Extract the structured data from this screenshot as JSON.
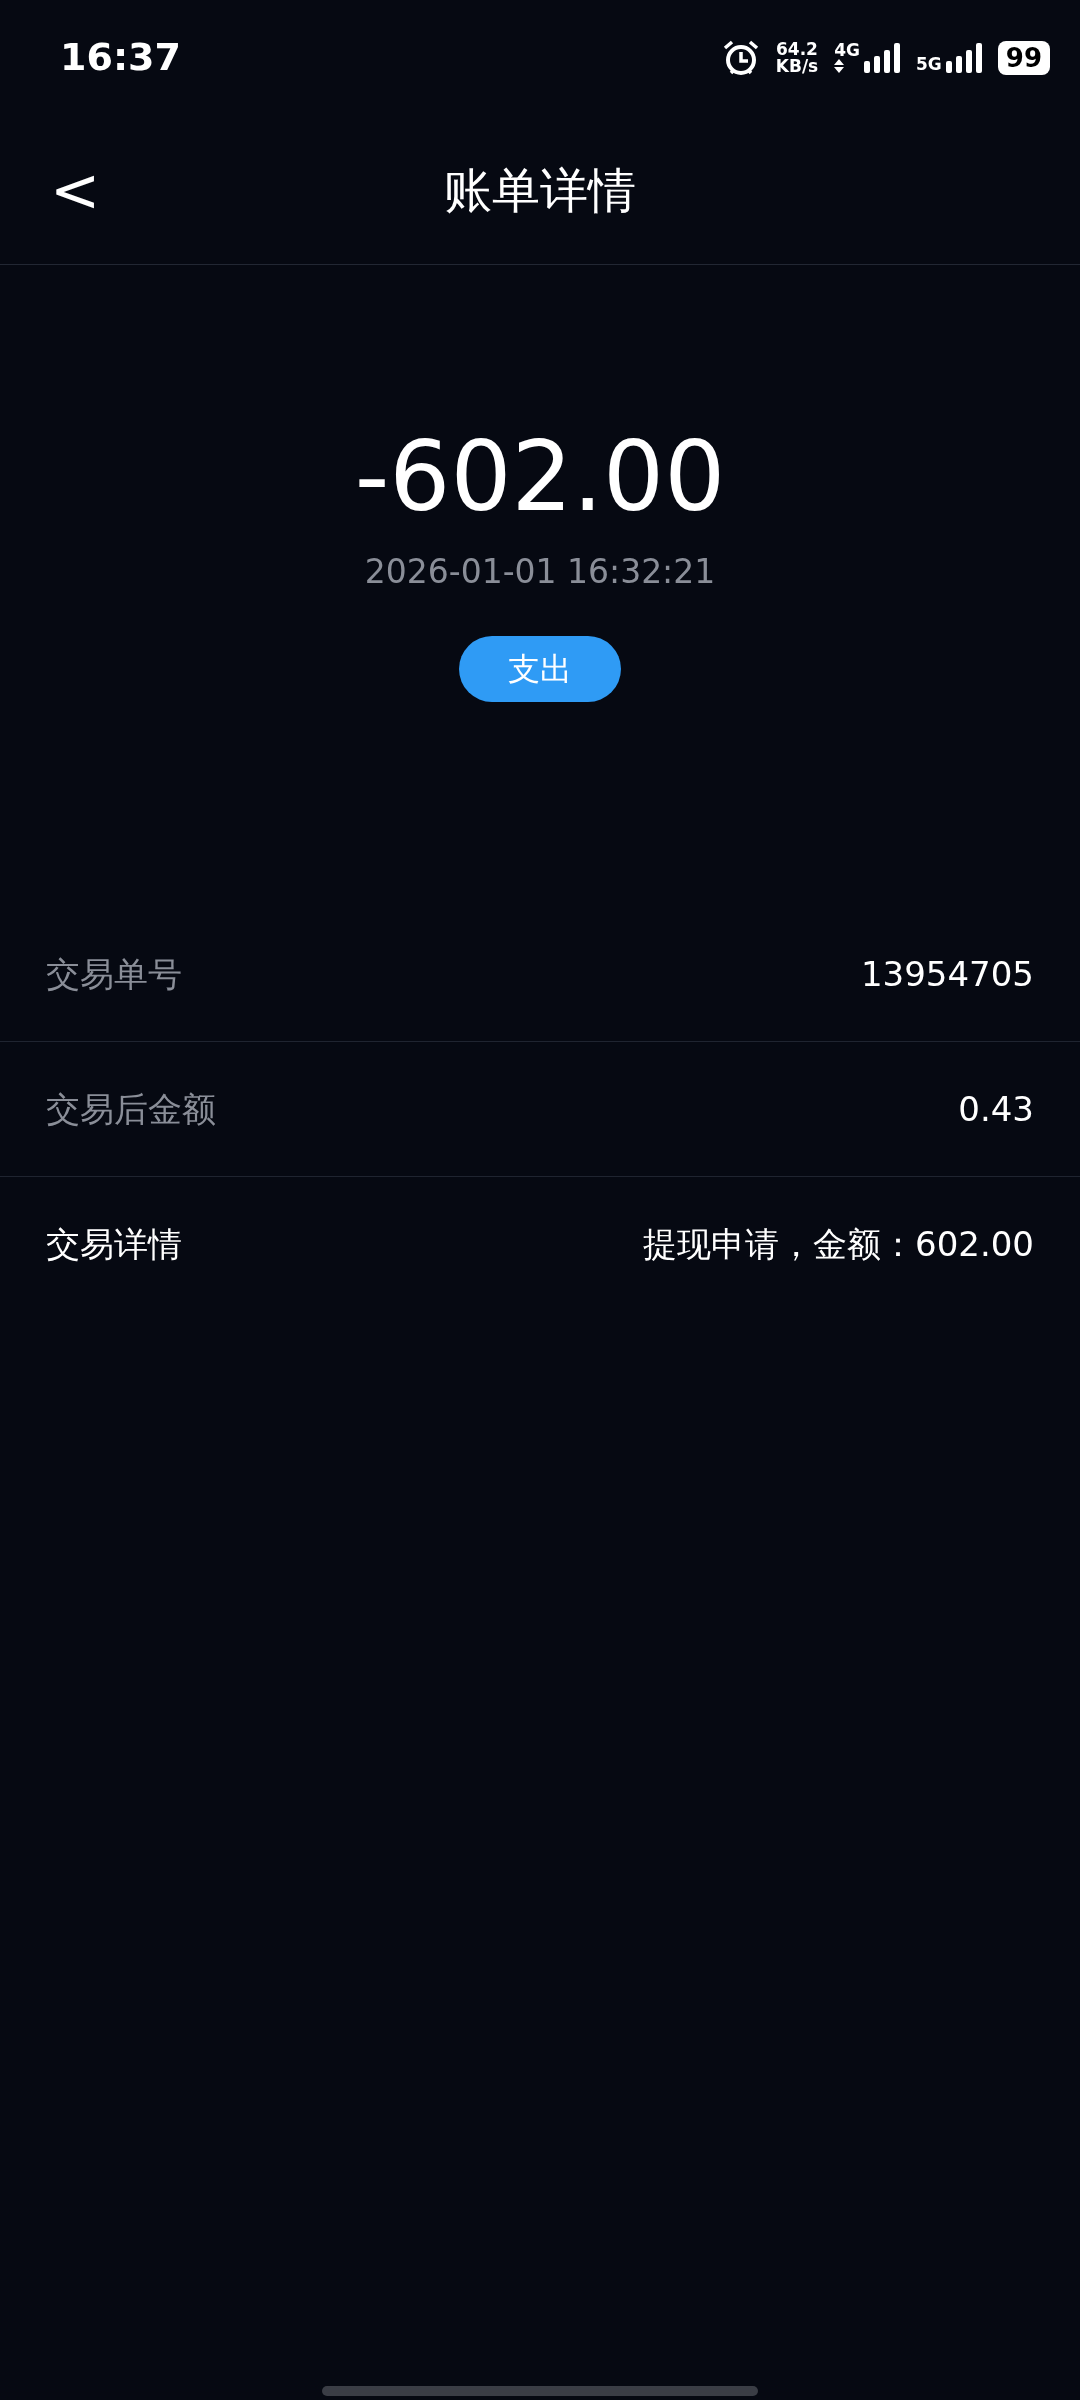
{
  "status_bar": {
    "time": "16:37",
    "speed_value": "64.2",
    "speed_unit": "KB/s",
    "networks": [
      {
        "label": "4G",
        "arrows": true
      },
      {
        "label": "5G",
        "arrows": false
      }
    ],
    "battery": "99"
  },
  "header": {
    "back": "<",
    "title": "账单详情"
  },
  "summary": {
    "amount": "-602.00",
    "datetime": "2026-01-01 16:32:21",
    "tag": "支出"
  },
  "rows": [
    {
      "label": "交易单号",
      "value": "13954705",
      "label_muted": true
    },
    {
      "label": "交易后金额",
      "value": "0.43",
      "label_muted": true
    },
    {
      "label": "交易详情",
      "value": "提现申请，金额：602.00",
      "label_muted": false
    }
  ]
}
